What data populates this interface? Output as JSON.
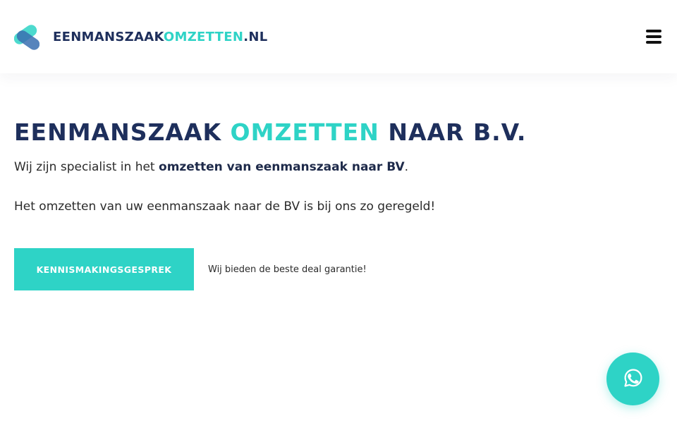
{
  "header": {
    "logo_main": "EENMANSZAAK",
    "logo_accent": "OMZETTEN",
    "logo_tld": ".NL",
    "menu_icon": "hamburger-menu-icon"
  },
  "hero": {
    "title_part1": "EENMANSZAAK",
    "title_accent": "OMZETTEN",
    "title_part2": "NAAR B.V.",
    "intro_prefix": "Wij zijn specialist in het",
    "intro_bold": "omzetten van eenmanszaak naar BV",
    "intro_suffix": ".",
    "subtext": "Het omzetten van uw eenmanszaak naar de BV is bij ons zo geregeld!"
  },
  "cta": {
    "button_label": "KENNISMAKINGSGESPREK",
    "note": "Wij bieden de beste deal garantie!"
  },
  "floating": {
    "whatsapp_icon": "whatsapp-icon"
  },
  "colors": {
    "accent": "#2ed3c6",
    "navy": "#1e2f5c",
    "text": "#2b2b2b"
  }
}
